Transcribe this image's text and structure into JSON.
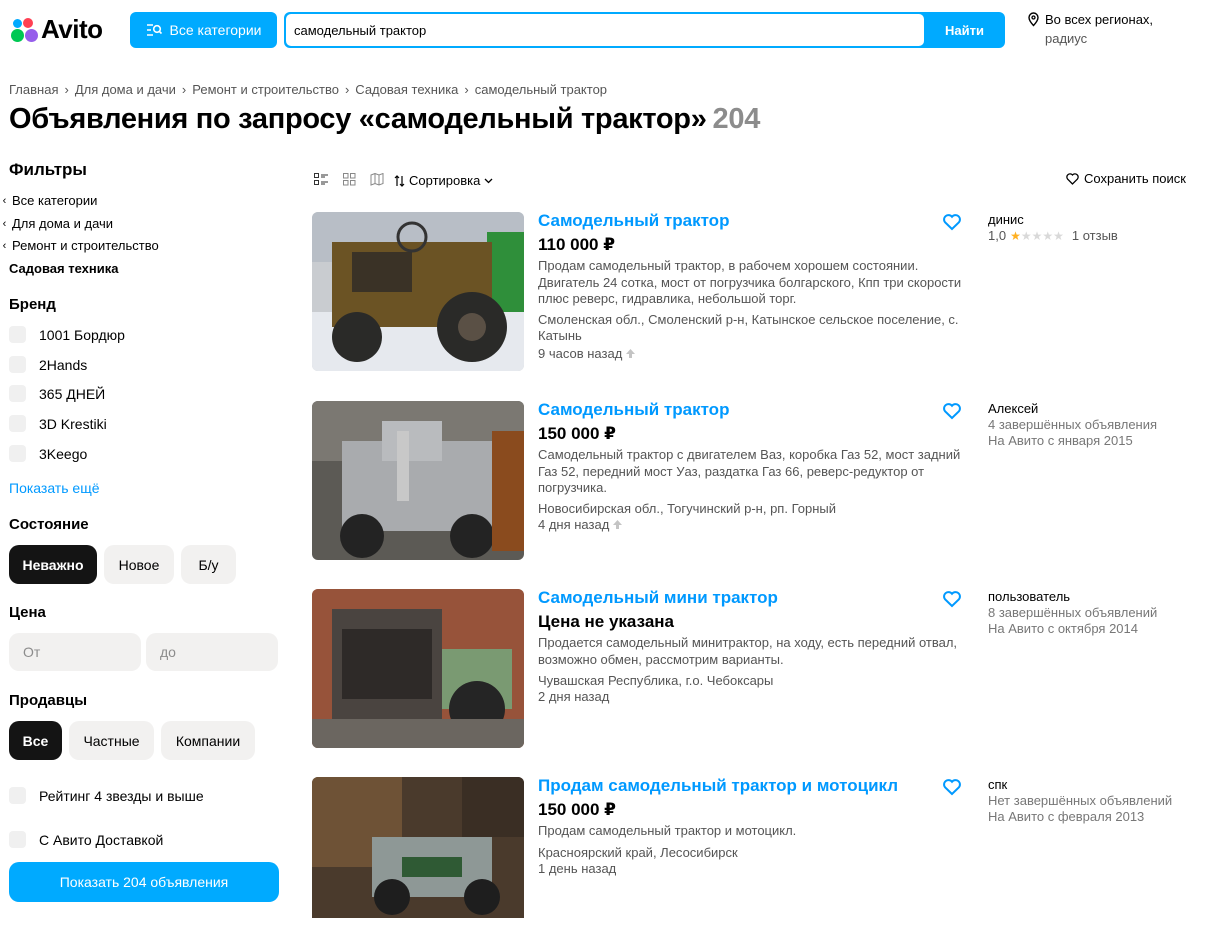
{
  "header": {
    "logo_text": "Avito",
    "categories_label": "Все категории",
    "search_value": "самодельный трактор",
    "search_button": "Найти",
    "region_line1": "Во всех регионах,",
    "region_line2": "радиус"
  },
  "breadcrumb": [
    "Главная",
    "Для дома и дачи",
    "Ремонт и строительство",
    "Садовая техника",
    "самодельный трактор"
  ],
  "page": {
    "title": "Объявления по запросу «самодельный трактор»",
    "count": "204"
  },
  "filters": {
    "title": "Фильтры",
    "categories": [
      "Все категории",
      "Для дома и дачи",
      "Ремонт и строительство"
    ],
    "current_category": "Садовая техника",
    "brand_title": "Бренд",
    "brands": [
      "1001 Бордюр",
      "2Hands",
      "365 ДНЕЙ",
      "3D Krestiki",
      "3Keego"
    ],
    "show_more": "Показать ещё",
    "condition_title": "Состояние",
    "conditions": [
      "Неважно",
      "Новое",
      "Б/у"
    ],
    "price_title": "Цена",
    "price_from": "От",
    "price_to": "до",
    "sellers_title": "Продавцы",
    "sellers": [
      "Все",
      "Частные",
      "Компании"
    ],
    "rating_option": "Рейтинг 4 звезды и выше",
    "delivery_option": "С Авито Доставкой",
    "show_button": "Показать 204 объявления"
  },
  "toolbar": {
    "sort_label": "Сортировка",
    "save_search": "Сохранить поиск"
  },
  "listings": [
    {
      "title": "Самодельный трактор",
      "price": "110 000 ₽",
      "desc": "Продам самодельный трактор, в рабочем хорошем состоянии. Двигатель 24 сотка, мост от погрузчика болгарского, Кпп три скорости плюс реверс, гидравлика, небольшой торг.",
      "location": "Смоленская обл., Смоленский р-н, Катынское сельское поселение, с. Катынь",
      "time": "9 часов назад",
      "seller_name": "динис",
      "rating": "1,0",
      "reviews": "1 отзыв"
    },
    {
      "title": "Самодельный трактор",
      "price": "150 000 ₽",
      "desc": "Самодельный трактор с двигателем Ваз, коробка Газ 52, мост задний Газ 52, передний мост Уаз, раздатка Газ 66, реверс-редуктор от погрузчика.",
      "location": "Новосибирская обл., Тогучинский р-н, рп. Горный",
      "time": "4 дня назад",
      "seller_name": "Алексей",
      "seller_line2": "4 завершённых объявления",
      "seller_line3": "На Авито с января 2015"
    },
    {
      "title": "Самодельный мини трактор",
      "price": "Цена не указана",
      "desc": "Продается самодельный минитрактор, на ходу, есть передний отвал, возможно обмен, рассмотрим варианты.",
      "location": "Чувашская Республика, г.о. Чебоксары",
      "time": "2 дня назад",
      "seller_name": "пользователь",
      "seller_line2": "8 завершённых объявлений",
      "seller_line3": "На Авито с октября 2014"
    },
    {
      "title": "Продам самодельный трактор и мотоцикл",
      "price": "150 000 ₽",
      "desc": "Продам самодельный трактор и мотоцикл.",
      "location": "Красноярский край, Лесосибирск",
      "time": "1 день назад",
      "seller_name": "спк",
      "seller_line2": "Нет завершённых объявлений",
      "seller_line3": "На Авито с февраля 2013"
    }
  ]
}
